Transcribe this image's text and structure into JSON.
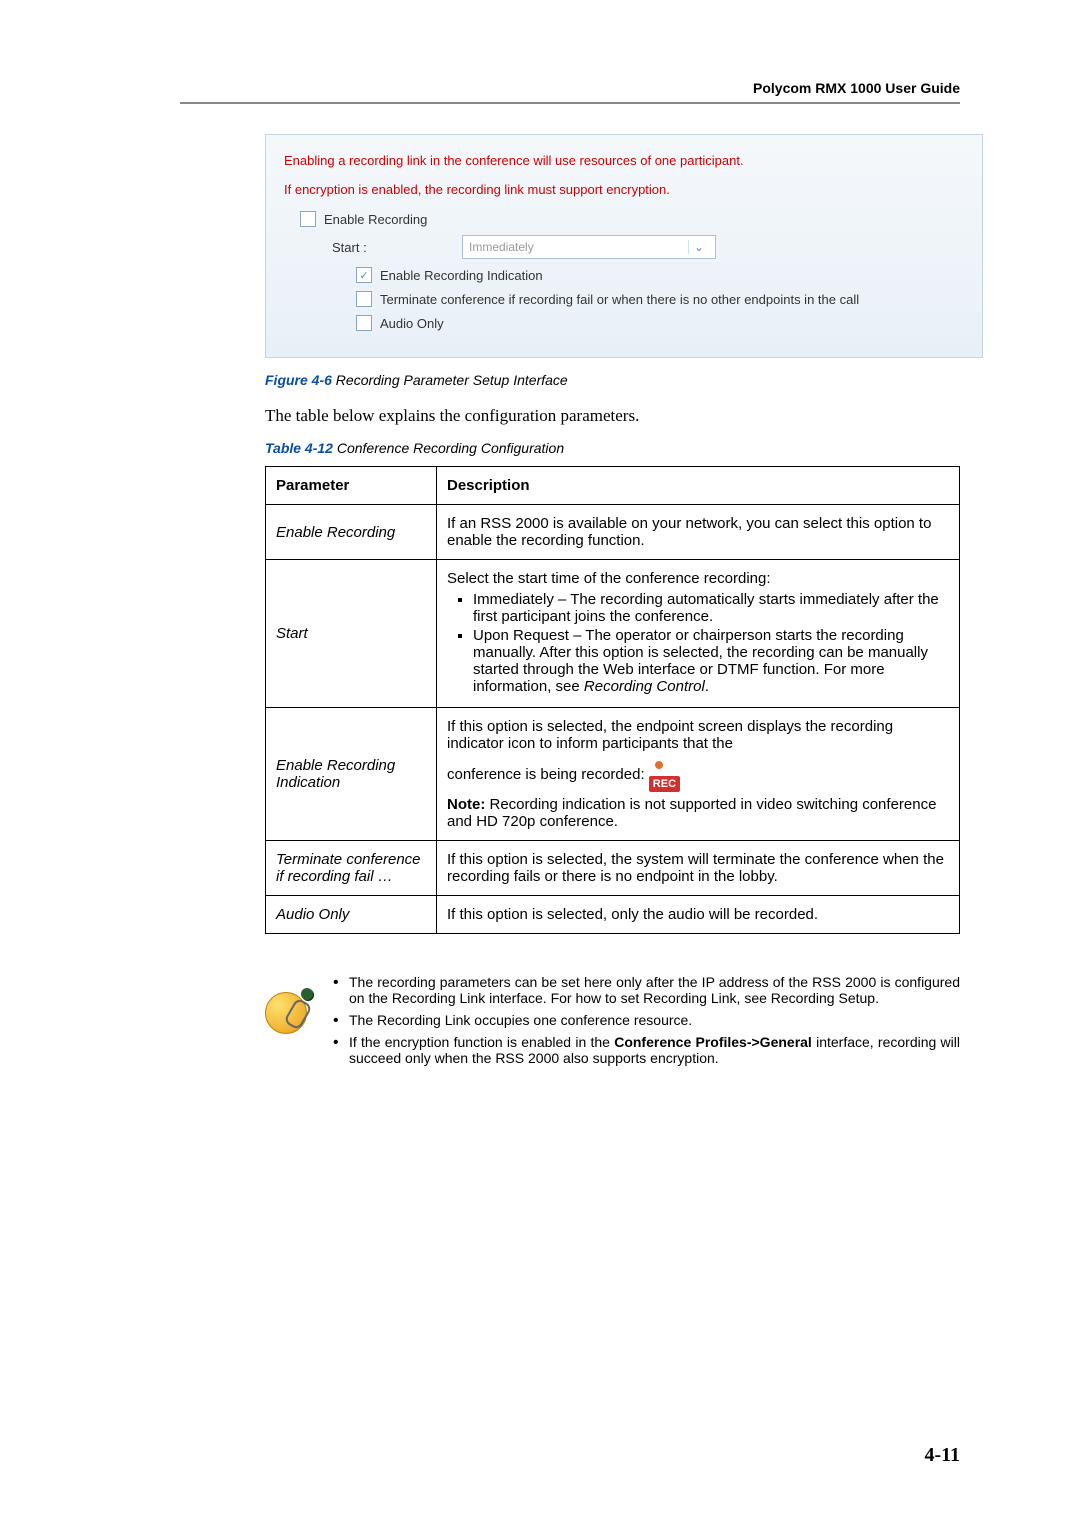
{
  "header": {
    "title": "Polycom RMX 1000 User Guide"
  },
  "screenshot": {
    "warn1": "Enabling a recording link in the conference will use resources of one participant.",
    "warn2": "If encryption is enabled, the recording link must support encryption.",
    "enable_recording": "Enable Recording",
    "start_label": "Start :",
    "start_value": "Immediately",
    "enable_indication": "Enable Recording Indication",
    "terminate": "Terminate conference if recording fail or when there is no other endpoints in the call",
    "audio_only": "Audio Only"
  },
  "figure": {
    "num": "Figure 4-6",
    "caption": " Recording Parameter Setup Interface"
  },
  "intro": "The table below explains the configuration parameters.",
  "table_caption": {
    "num": "Table 4-12",
    "caption": " Conference Recording Configuration"
  },
  "table": {
    "header_param": "Parameter",
    "header_desc": "Description",
    "rows": [
      {
        "param": "Enable Recording",
        "desc": "If an RSS 2000 is available on your network, you can select this option to enable the recording function."
      },
      {
        "param": "Start",
        "lead": "Select the start time of the conference recording:",
        "b1": "Immediately – The recording automatically starts immediately after the first participant joins the conference.",
        "b2a": "Upon Request – The operator or chairperson starts the recording manually. After this option is selected, the recording can be manually started through the Web interface or DTMF function. For more information, see ",
        "b2b": "Recording Control",
        "b2c": "."
      },
      {
        "param": "Enable Recording Indication",
        "d1": "If this option is selected, the endpoint screen displays the recording indicator icon to inform participants that the",
        "d2": "conference is being recorded: ",
        "rec": "REC",
        "d3a": "Note:",
        "d3b": " Recording indication is not supported in video switching conference and HD 720p conference."
      },
      {
        "param": "Terminate conference if recording fail …",
        "desc": "If this option is selected, the system will terminate the conference when the recording fails or there is no endpoint in the lobby."
      },
      {
        "param": "Audio Only",
        "desc": "If this option is selected, only the audio will be recorded."
      }
    ]
  },
  "notes": {
    "n1": "The recording parameters can be set here only after the IP address of the RSS 2000 is configured on the Recording Link interface. For how to set Recording Link, see Recording Setup.",
    "n2": "The Recording Link occupies one conference resource.",
    "n3a": "If the encryption function is enabled in the ",
    "n3b": "Conference Profiles->General",
    "n3c": " interface, recording will succeed only when the RSS 2000 also supports encryption."
  },
  "page_number": "4-11"
}
